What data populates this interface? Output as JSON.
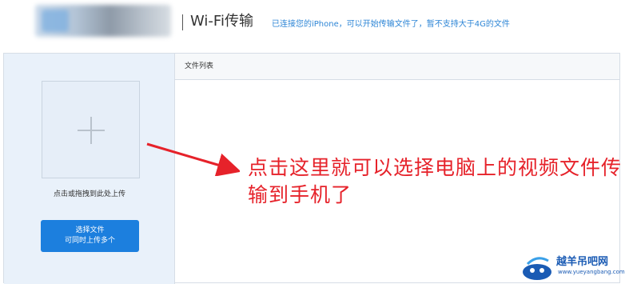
{
  "header": {
    "title": "Wi-Fi传输",
    "subtitle": "已连接您的iPhone，可以开始传输文件了，暂不支持大于4G的文件"
  },
  "upload": {
    "drop_hint": "点击或拖拽到此处上传",
    "select_button_line1": "选择文件",
    "select_button_line2": "可同时上传多个"
  },
  "file_list": {
    "title": "文件列表"
  },
  "annotation": {
    "text": "点击这里就可以选择电脑上的视频文件传输到手机了",
    "color": "#e6222a"
  },
  "watermark": {
    "site_name": "越羊吊吧网",
    "url": "www.yueyangbang.com"
  },
  "colors": {
    "accent": "#1c7fde",
    "subtitle": "#2e86d6",
    "sidebar_bg": "#e9f1fa"
  }
}
